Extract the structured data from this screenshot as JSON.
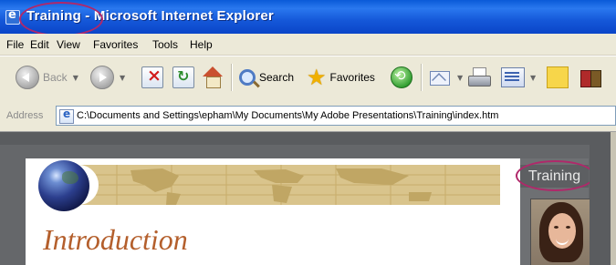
{
  "window": {
    "title_page": "Training",
    "title_app": "Microsoft Internet Explorer",
    "title_separator": " - "
  },
  "menu": [
    "File",
    "Edit",
    "View",
    "Favorites",
    "Tools",
    "Help"
  ],
  "toolbar": {
    "back_label": "Back",
    "search_label": "Search",
    "favorites_label": "Favorites"
  },
  "address": {
    "label": "Address",
    "url": "C:\\Documents and Settings\\epham\\My Documents\\My Adobe Presentations\\Training\\index.htm"
  },
  "page": {
    "heading": "Introduction",
    "sidebar_label": "Training"
  },
  "colors": {
    "highlight_ring": "#b0286a",
    "heading": "#b45f2c",
    "banner": "#d9c48c",
    "titlebar": "#0a5ad8"
  }
}
